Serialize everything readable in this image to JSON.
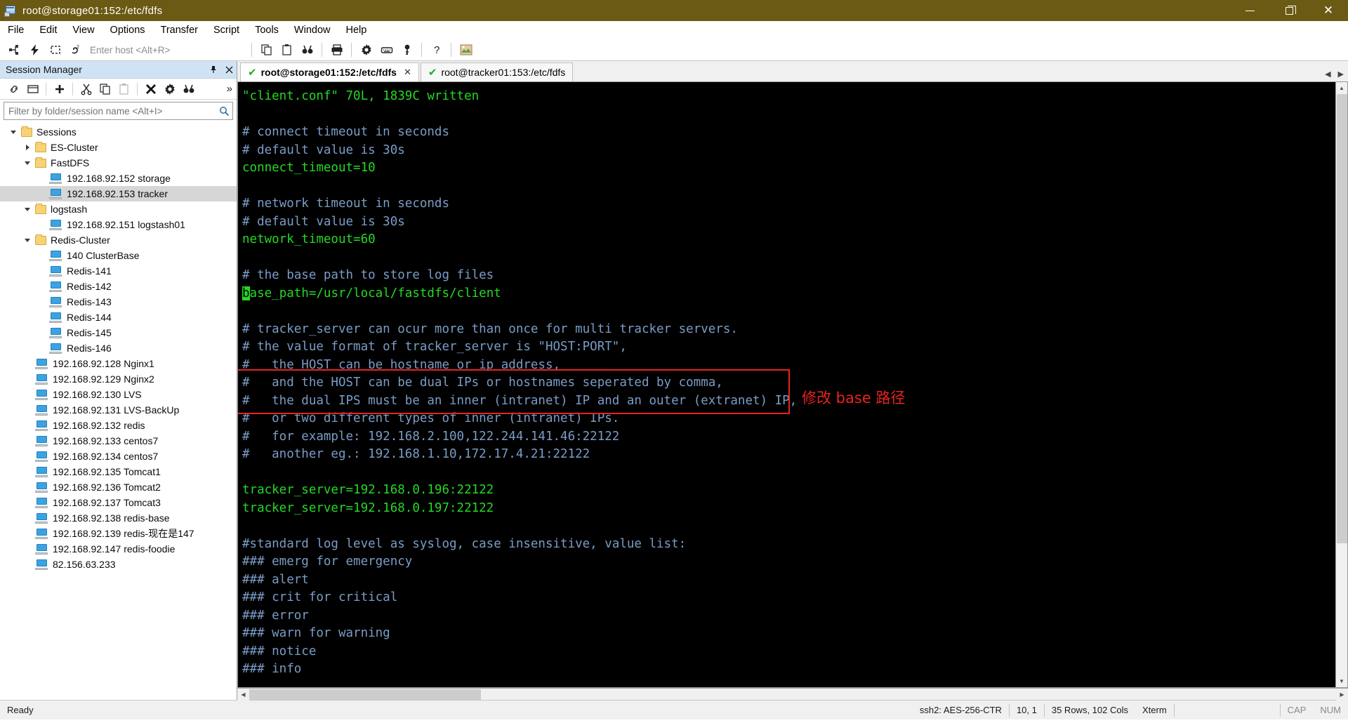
{
  "window": {
    "title": "root@storage01:152:/etc/fdfs",
    "icon": "securecrt-icon",
    "controls": {
      "minimize": "minimize-icon",
      "maximize": "maximize-icon",
      "close": "close-icon"
    }
  },
  "menubar": {
    "items": [
      "File",
      "Edit",
      "View",
      "Options",
      "Transfer",
      "Script",
      "Tools",
      "Window",
      "Help"
    ]
  },
  "toolbar": {
    "host_placeholder": "Enter host <Alt+R>",
    "icons": [
      "connect-icon",
      "quick-connect-icon",
      "reconnect-all-icon",
      "connect-sftp-icon",
      "copy-icon",
      "paste-icon",
      "find-icon",
      "print-icon",
      "settings-icon",
      "keymap-editor-icon",
      "key-icon",
      "help-icon",
      "screenshot-icon"
    ]
  },
  "session_manager": {
    "title": "Session Manager",
    "pin": "pin-icon",
    "close": "close-icon",
    "toolbar_icons": [
      "link-icon",
      "new-window-icon",
      "add-icon",
      "cut-icon",
      "copy-icon",
      "paste-icon",
      "delete-icon",
      "properties-icon",
      "find-icon",
      "overflow-icon"
    ],
    "filter_placeholder": "Filter by folder/session name <Alt+I>",
    "search_icon": "search-icon",
    "tree": [
      {
        "label": "Sessions",
        "type": "folder",
        "depth": 0,
        "expanded": true,
        "selected": false
      },
      {
        "label": "ES-Cluster",
        "type": "folder",
        "depth": 1,
        "expanded": false,
        "selected": false
      },
      {
        "label": "FastDFS",
        "type": "folder",
        "depth": 1,
        "expanded": true,
        "selected": false
      },
      {
        "label": "192.168.92.152 storage",
        "type": "session",
        "depth": 2,
        "selected": false
      },
      {
        "label": "192.168.92.153 tracker",
        "type": "session",
        "depth": 2,
        "selected": true
      },
      {
        "label": "logstash",
        "type": "folder",
        "depth": 1,
        "expanded": true,
        "selected": false
      },
      {
        "label": "192.168.92.151 logstash01",
        "type": "session",
        "depth": 2,
        "selected": false
      },
      {
        "label": "Redis-Cluster",
        "type": "folder",
        "depth": 1,
        "expanded": true,
        "selected": false
      },
      {
        "label": "140 ClusterBase",
        "type": "session",
        "depth": 2,
        "selected": false
      },
      {
        "label": "Redis-141",
        "type": "session",
        "depth": 2,
        "selected": false
      },
      {
        "label": "Redis-142",
        "type": "session",
        "depth": 2,
        "selected": false
      },
      {
        "label": "Redis-143",
        "type": "session",
        "depth": 2,
        "selected": false
      },
      {
        "label": "Redis-144",
        "type": "session",
        "depth": 2,
        "selected": false
      },
      {
        "label": "Redis-145",
        "type": "session",
        "depth": 2,
        "selected": false
      },
      {
        "label": "Redis-146",
        "type": "session",
        "depth": 2,
        "selected": false
      },
      {
        "label": "192.168.92.128 Nginx1",
        "type": "session",
        "depth": 1,
        "selected": false
      },
      {
        "label": "192.168.92.129 Nginx2",
        "type": "session",
        "depth": 1,
        "selected": false
      },
      {
        "label": "192.168.92.130 LVS",
        "type": "session",
        "depth": 1,
        "selected": false
      },
      {
        "label": "192.168.92.131 LVS-BackUp",
        "type": "session",
        "depth": 1,
        "selected": false
      },
      {
        "label": "192.168.92.132 redis",
        "type": "session",
        "depth": 1,
        "selected": false
      },
      {
        "label": "192.168.92.133 centos7",
        "type": "session",
        "depth": 1,
        "selected": false
      },
      {
        "label": "192.168.92.134 centos7",
        "type": "session",
        "depth": 1,
        "selected": false
      },
      {
        "label": "192.168.92.135 Tomcat1",
        "type": "session",
        "depth": 1,
        "selected": false
      },
      {
        "label": "192.168.92.136 Tomcat2",
        "type": "session",
        "depth": 1,
        "selected": false
      },
      {
        "label": "192.168.92.137 Tomcat3",
        "type": "session",
        "depth": 1,
        "selected": false
      },
      {
        "label": "192.168.92.138 redis-base",
        "type": "session",
        "depth": 1,
        "selected": false
      },
      {
        "label": "192.168.92.139 redis-现在是147",
        "type": "session",
        "depth": 1,
        "selected": false
      },
      {
        "label": "192.168.92.147 redis-foodie",
        "type": "session",
        "depth": 1,
        "selected": false
      },
      {
        "label": "82.156.63.233",
        "type": "session",
        "depth": 1,
        "selected": false
      }
    ]
  },
  "tabs": [
    {
      "label": "root@storage01:152:/etc/fdfs",
      "active": true,
      "status_icon": "check-icon",
      "close_icon": "close-icon"
    },
    {
      "label": "root@tracker01:153:/etc/fdfs",
      "active": false,
      "status_icon": "check-icon"
    }
  ],
  "terminal": {
    "lines": [
      {
        "segs": [
          {
            "t": "\"client.conf\" 70L, 1839C written",
            "c": "val"
          }
        ]
      },
      {
        "segs": [
          {
            "t": "",
            "c": "cmt"
          }
        ]
      },
      {
        "segs": [
          {
            "t": "# connect timeout in seconds",
            "c": "cmt"
          }
        ]
      },
      {
        "segs": [
          {
            "t": "# default value is 30s",
            "c": "cmt"
          }
        ]
      },
      {
        "segs": [
          {
            "t": "connect_timeout=10",
            "c": "val"
          }
        ]
      },
      {
        "segs": [
          {
            "t": "",
            "c": "cmt"
          }
        ]
      },
      {
        "segs": [
          {
            "t": "# network timeout in seconds",
            "c": "cmt"
          }
        ]
      },
      {
        "segs": [
          {
            "t": "# default value is 30s",
            "c": "cmt"
          }
        ]
      },
      {
        "segs": [
          {
            "t": "network_timeout=60",
            "c": "val"
          }
        ]
      },
      {
        "segs": [
          {
            "t": "",
            "c": "cmt"
          }
        ]
      },
      {
        "segs": [
          {
            "t": "# the base path to store log files",
            "c": "cmt"
          }
        ]
      },
      {
        "segs": [
          {
            "t": "b",
            "c": "cursor"
          },
          {
            "t": "ase_path=/usr/local/fastdfs/client",
            "c": "val"
          }
        ]
      },
      {
        "segs": [
          {
            "t": "",
            "c": "cmt"
          }
        ]
      },
      {
        "segs": [
          {
            "t": "# tracker_server can ocur more than once for multi tracker servers.",
            "c": "cmt"
          }
        ]
      },
      {
        "segs": [
          {
            "t": "# the value format of tracker_server is \"HOST:PORT\",",
            "c": "cmt"
          }
        ]
      },
      {
        "segs": [
          {
            "t": "#   the HOST can be hostname or ip address,",
            "c": "cmt"
          }
        ]
      },
      {
        "segs": [
          {
            "t": "#   and the HOST can be dual IPs or hostnames seperated by comma,",
            "c": "cmt"
          }
        ]
      },
      {
        "segs": [
          {
            "t": "#   the dual IPS must be an inner (intranet) IP and an outer (extranet) IP,",
            "c": "cmt"
          }
        ]
      },
      {
        "segs": [
          {
            "t": "#   or two different types of inner (intranet) IPs.",
            "c": "cmt"
          }
        ]
      },
      {
        "segs": [
          {
            "t": "#   for example: 192.168.2.100,122.244.141.46:22122",
            "c": "cmt"
          }
        ]
      },
      {
        "segs": [
          {
            "t": "#   another eg.: 192.168.1.10,172.17.4.21:22122",
            "c": "cmt"
          }
        ]
      },
      {
        "segs": [
          {
            "t": "",
            "c": "cmt"
          }
        ]
      },
      {
        "segs": [
          {
            "t": "tracker_server=192.168.0.196:22122",
            "c": "val"
          }
        ]
      },
      {
        "segs": [
          {
            "t": "tracker_server=192.168.0.197:22122",
            "c": "val"
          }
        ]
      },
      {
        "segs": [
          {
            "t": "",
            "c": "cmt"
          }
        ]
      },
      {
        "segs": [
          {
            "t": "#standard log level as syslog, case insensitive, value list:",
            "c": "cmt"
          }
        ]
      },
      {
        "segs": [
          {
            "t": "### emerg for emergency",
            "c": "cmt"
          }
        ]
      },
      {
        "segs": [
          {
            "t": "### alert",
            "c": "cmt"
          }
        ]
      },
      {
        "segs": [
          {
            "t": "### crit for critical",
            "c": "cmt"
          }
        ]
      },
      {
        "segs": [
          {
            "t": "### error",
            "c": "cmt"
          }
        ]
      },
      {
        "segs": [
          {
            "t": "### warn for warning",
            "c": "cmt"
          }
        ]
      },
      {
        "segs": [
          {
            "t": "### notice",
            "c": "cmt"
          }
        ]
      },
      {
        "segs": [
          {
            "t": "### info",
            "c": "cmt"
          }
        ]
      }
    ],
    "colors": {
      "background": "#000000",
      "comment": "#7a9cc6",
      "value": "#25d825",
      "cursor": "#25d825"
    }
  },
  "annotation": {
    "text": "修改 base 路径",
    "color": "#e8231f"
  },
  "statusbar": {
    "state": "Ready",
    "cipher": "ssh2: AES-256-CTR",
    "position": "10, 1",
    "size": "35 Rows, 102 Cols",
    "emulation": "Xterm",
    "caps": "CAP",
    "num": "NUM"
  }
}
